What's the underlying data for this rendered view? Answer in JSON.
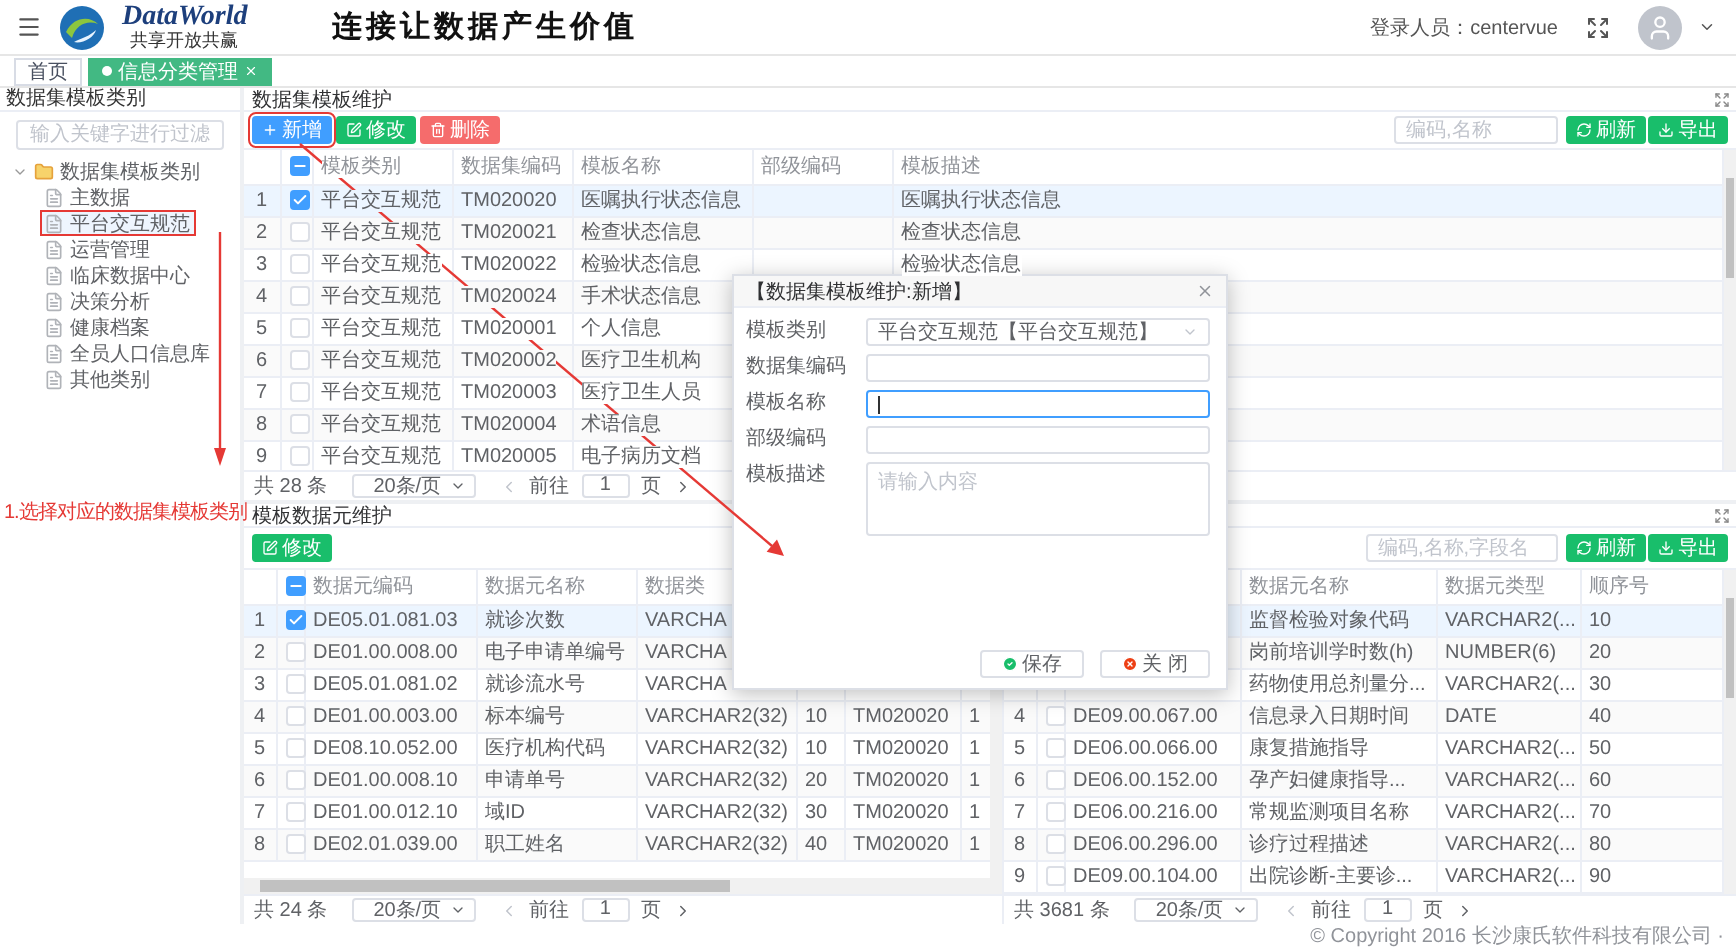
{
  "header": {
    "brand": "DataWorld",
    "tagline": "共享开放共赢",
    "slogan": "连接让数据产生价值",
    "user_label": "登录人员：centervue"
  },
  "tabs": [
    {
      "label": "首页",
      "selected": false,
      "closable": false
    },
    {
      "label": "信息分类管理",
      "selected": true,
      "closable": true
    }
  ],
  "sidebar": {
    "title": "数据集模板类别",
    "search_placeholder": "输入关键字进行过滤",
    "tree": [
      {
        "label": "数据集模板类别",
        "expanded": true,
        "children": [
          {
            "label": "主数据",
            "selected": false,
            "highlighted": false
          },
          {
            "label": "平台交互规范",
            "selected": true,
            "highlighted": true
          },
          {
            "label": "运营管理",
            "selected": false,
            "highlighted": false
          },
          {
            "label": "临床数据中心",
            "selected": false,
            "highlighted": false
          },
          {
            "label": "决策分析",
            "selected": false,
            "highlighted": false
          },
          {
            "label": "健康档案",
            "selected": false,
            "highlighted": false
          },
          {
            "label": "全员人口信息库",
            "selected": false,
            "highlighted": false
          },
          {
            "label": "其他类别",
            "selected": false,
            "highlighted": false
          }
        ]
      }
    ]
  },
  "annotation": "1.选择对应的数据集模板类别",
  "templates": {
    "title": "数据集模板维护",
    "buttons": [
      {
        "kind": "add",
        "label": "新增",
        "highlighted": true
      },
      {
        "kind": "edit",
        "label": "修改",
        "highlighted": false
      },
      {
        "kind": "delete",
        "label": "删除",
        "highlighted": false
      }
    ],
    "search_placeholder": "编码,名称",
    "actions": [
      {
        "kind": "refresh",
        "label": "刷新"
      },
      {
        "kind": "export",
        "label": "导出"
      }
    ],
    "some_checked": true,
    "columns": [
      "模板类别",
      "数据集编码",
      "模板名称",
      "部级编码",
      "模板描述"
    ],
    "rows": [
      {
        "index": "1",
        "checked": true,
        "selected": true,
        "cells": [
          "平台交互规范",
          "TM020020",
          "医嘱执行状态信息",
          null,
          "医嘱执行状态信息"
        ]
      },
      {
        "index": "2",
        "checked": false,
        "selected": false,
        "cells": [
          "平台交互规范",
          "TM020021",
          "检查状态信息",
          null,
          "检查状态信息"
        ]
      },
      {
        "index": "3",
        "checked": false,
        "selected": false,
        "cells": [
          "平台交互规范",
          "TM020022",
          "检验状态信息",
          null,
          "检验状态信息"
        ]
      },
      {
        "index": "4",
        "checked": false,
        "selected": false,
        "cells": [
          "平台交互规范",
          "TM020024",
          "手术状态信息",
          null,
          null
        ]
      },
      {
        "index": "5",
        "checked": false,
        "selected": false,
        "cells": [
          "平台交互规范",
          "TM020001",
          "个人信息",
          null,
          null
        ]
      },
      {
        "index": "6",
        "checked": false,
        "selected": false,
        "cells": [
          "平台交互规范",
          "TM020002",
          "医疗卫生机构",
          null,
          null
        ]
      },
      {
        "index": "7",
        "checked": false,
        "selected": false,
        "cells": [
          "平台交互规范",
          "TM020003",
          "医疗卫生人员",
          null,
          null
        ]
      },
      {
        "index": "8",
        "checked": false,
        "selected": false,
        "cells": [
          "平台交互规范",
          "TM020004",
          "术语信息",
          null,
          null
        ]
      },
      {
        "index": "9",
        "checked": false,
        "selected": false,
        "cells": [
          "平台交互规范",
          "TM020005",
          "电子病历文档",
          null,
          null
        ]
      }
    ],
    "pager": {
      "total": "共 28 条",
      "page_size": "20条/页",
      "goto": "前往",
      "page": "1",
      "unit": "页"
    }
  },
  "elements": {
    "title": "模板数据元维护",
    "left": {
      "buttons": [
        {
          "kind": "edit",
          "label": "修改",
          "highlighted": false
        }
      ],
      "some_checked": true,
      "columns": [
        "数据元编码",
        "数据元名称",
        "数据类",
        null,
        null,
        null,
        null
      ],
      "rows": [
        {
          "index": "1",
          "checked": true,
          "selected": true,
          "cells": [
            "DE05.01.081.03",
            "就诊次数",
            "VARCHA",
            null,
            null,
            null,
            null
          ]
        },
        {
          "index": "2",
          "checked": false,
          "selected": false,
          "cells": [
            "DE01.00.008.00",
            "电子申请单编号",
            "VARCHA",
            null,
            null,
            null,
            null
          ]
        },
        {
          "index": "3",
          "checked": false,
          "selected": false,
          "cells": [
            "DE05.01.081.02",
            "就诊流水号",
            "VARCHA",
            null,
            null,
            null,
            null
          ]
        },
        {
          "index": "4",
          "checked": false,
          "selected": false,
          "cells": [
            "DE01.00.003.00",
            "标本编号",
            "VARCHAR2(32)",
            "10",
            "TM020020",
            "1",
            null
          ]
        },
        {
          "index": "5",
          "checked": false,
          "selected": false,
          "cells": [
            "DE08.10.052.00",
            "医疗机构代码",
            "VARCHAR2(32)",
            "10",
            "TM020020",
            "1",
            null
          ]
        },
        {
          "index": "6",
          "checked": false,
          "selected": false,
          "cells": [
            "DE01.00.008.10",
            "申请单号",
            "VARCHAR2(32)",
            "20",
            "TM020020",
            "1",
            null
          ]
        },
        {
          "index": "7",
          "checked": false,
          "selected": false,
          "cells": [
            "DE01.00.012.10",
            "域ID",
            "VARCHAR2(32)",
            "30",
            "TM020020",
            "1",
            null
          ]
        },
        {
          "index": "8",
          "checked": false,
          "selected": false,
          "cells": [
            "DE02.01.039.00",
            "职工姓名",
            "VARCHAR2(32)",
            "40",
            "TM020020",
            "1",
            null
          ]
        }
      ],
      "pager": {
        "total": "共 24 条",
        "page_size": "20条/页",
        "goto": "前往",
        "page": "1",
        "unit": "页"
      }
    },
    "right": {
      "search_placeholder": "编码,名称,字段名",
      "actions": [
        {
          "kind": "refresh",
          "label": "刷新"
        },
        {
          "kind": "export",
          "label": "导出"
        }
      ],
      "columns": [
        null,
        "数据元名称",
        "数据元类型",
        "顺序号"
      ],
      "rows": [
        {
          "selected": true,
          "cells": [
            null,
            "监督检验对象代码",
            "VARCHAR2(...",
            "10"
          ]
        },
        {
          "selected": false,
          "cells": [
            null,
            "岗前培训学时数(h)",
            "NUMBER(6)",
            "20"
          ]
        },
        {
          "selected": false,
          "cells": [
            null,
            "药物使用总剂量分...",
            "VARCHAR2(...",
            "30"
          ]
        },
        {
          "index": "4",
          "checked": false,
          "selected": false,
          "cells": [
            "DE09.00.067.00",
            "信息录入日期时间",
            "DATE",
            "40"
          ]
        },
        {
          "index": "5",
          "checked": false,
          "selected": false,
          "cells": [
            "DE06.00.066.00",
            "康复措施指导",
            "VARCHAR2(...",
            "50"
          ]
        },
        {
          "index": "6",
          "checked": false,
          "selected": false,
          "cells": [
            "DE06.00.152.00",
            "孕产妇健康指导...",
            "VARCHAR2(...",
            "60"
          ]
        },
        {
          "index": "7",
          "checked": false,
          "selected": false,
          "cells": [
            "DE06.00.216.00",
            "常规监测项目名称",
            "VARCHAR2(...",
            "70"
          ]
        },
        {
          "index": "8",
          "checked": false,
          "selected": false,
          "cells": [
            "DE06.00.296.00",
            "诊疗过程描述",
            "VARCHAR2(...",
            "80"
          ]
        },
        {
          "index": "9",
          "checked": false,
          "selected": false,
          "cells": [
            "DE09.00.104.00",
            "出院诊断-主要诊...",
            "VARCHAR2(...",
            "90"
          ]
        }
      ],
      "pager": {
        "total": "共 3681 条",
        "page_size": "20条/页",
        "goto": "前往",
        "page": "1",
        "unit": "页"
      }
    }
  },
  "dialog": {
    "title": "【数据集模板维护:新增】",
    "fields": [
      {
        "kind": "select",
        "label": "模板类别",
        "value": "平台交互规范【平台交互规范】",
        "focused": false
      },
      {
        "kind": "text",
        "label": "数据集编码",
        "focused": false
      },
      {
        "kind": "text",
        "label": "模板名称",
        "focused": true
      },
      {
        "kind": "text",
        "label": "部级编码",
        "focused": false
      },
      {
        "kind": "textarea",
        "label": "模板描述",
        "placeholder": "请输入内容",
        "focused": false
      }
    ],
    "buttons": [
      {
        "kind": "save",
        "label": "保存"
      },
      {
        "kind": "close",
        "label": "关 闭"
      }
    ]
  },
  "footer": "© Copyright 2016 长沙康氏软件科技有限公司 ·"
}
